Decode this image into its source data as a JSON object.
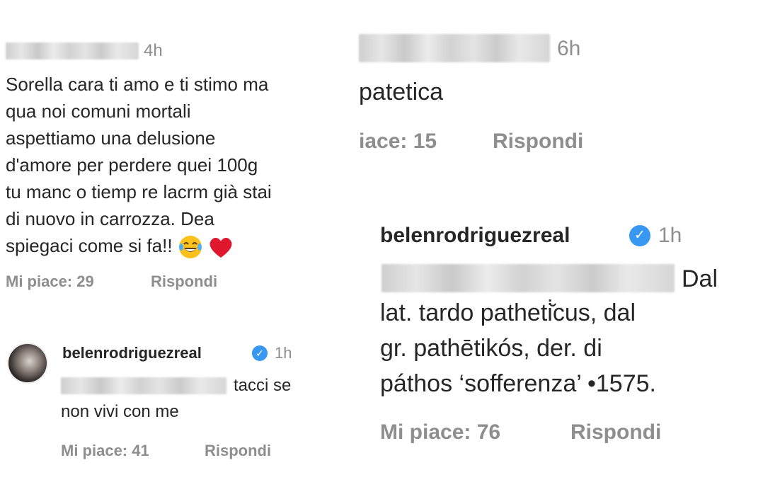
{
  "left": {
    "comment1": {
      "time": "4h",
      "lines": [
        "Sorella cara ti amo e ti stimo ma",
        "qua noi comuni mortali",
        "aspettiamo una delusione",
        "d'amore per perdere quei 100g",
        "tu manc o tiemp re lacrm già stai",
        "di nuovo in carrozza. Dea",
        "spiegaci come si fa!!"
      ],
      "emojis": [
        "laughing-tears-emoji",
        "red-heart-emoji"
      ],
      "likes": "Mi piace: 29",
      "reply": "Rispondi"
    },
    "reply1": {
      "username": "belenrodriguezreal",
      "time": "1h",
      "line1": "tacci se",
      "line2": "non vivi con me",
      "likes": "Mi piace: 41",
      "reply": "Rispondi"
    }
  },
  "right": {
    "comment2": {
      "time": "6h",
      "text": "patetica",
      "likes": "iace: 15",
      "reply": "Rispondi"
    },
    "reply2": {
      "username": "belenrodriguezreal",
      "time": "1h",
      "line1": "Dal",
      "line2": "lat. tardo patheti̇̆cus, dal",
      "line3": "gr. pathētikós, der. di",
      "line4": "páthos ‘sofferenza’ •1575.",
      "likes": "Mi piace: 76",
      "reply": "Rispondi"
    }
  },
  "colors": {
    "verified": "#3897f0",
    "meta": "#8e8e8e",
    "text": "#262626"
  }
}
